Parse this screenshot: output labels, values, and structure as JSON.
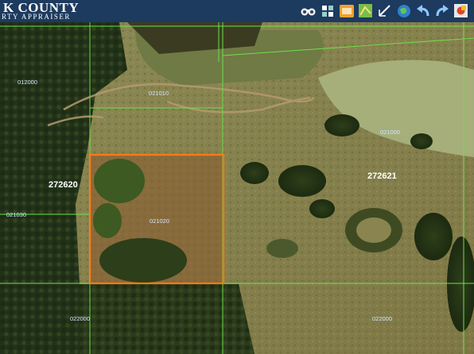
{
  "header": {
    "county_title": "K COUNTY",
    "subtitle": "RTY APPRAISER"
  },
  "toolbar": {
    "tools": [
      {
        "icon": "binoculars-icon"
      },
      {
        "icon": "layers-grid-icon"
      },
      {
        "icon": "photo-icon"
      },
      {
        "icon": "map-icon"
      },
      {
        "icon": "measure-icon"
      },
      {
        "icon": "globe-icon"
      },
      {
        "icon": "undo-icon"
      },
      {
        "icon": "redo-icon"
      },
      {
        "icon": "print-icon"
      }
    ]
  },
  "map": {
    "parcel_numbers": {
      "p272620": "272620",
      "p272621": "272621",
      "p021010": "021010",
      "p012000": "012000",
      "p021000": "021000",
      "p021030": "021030",
      "p021020": "021020",
      "p022000": "022000",
      "p022000b": "022000"
    },
    "colors": {
      "parcel_line": "#6fe04a",
      "selected_parcel": "#ff7a14",
      "label_text": "#ffffff",
      "lot_label": "#cfe6ff",
      "header_bg": "#1d3a5f"
    }
  }
}
